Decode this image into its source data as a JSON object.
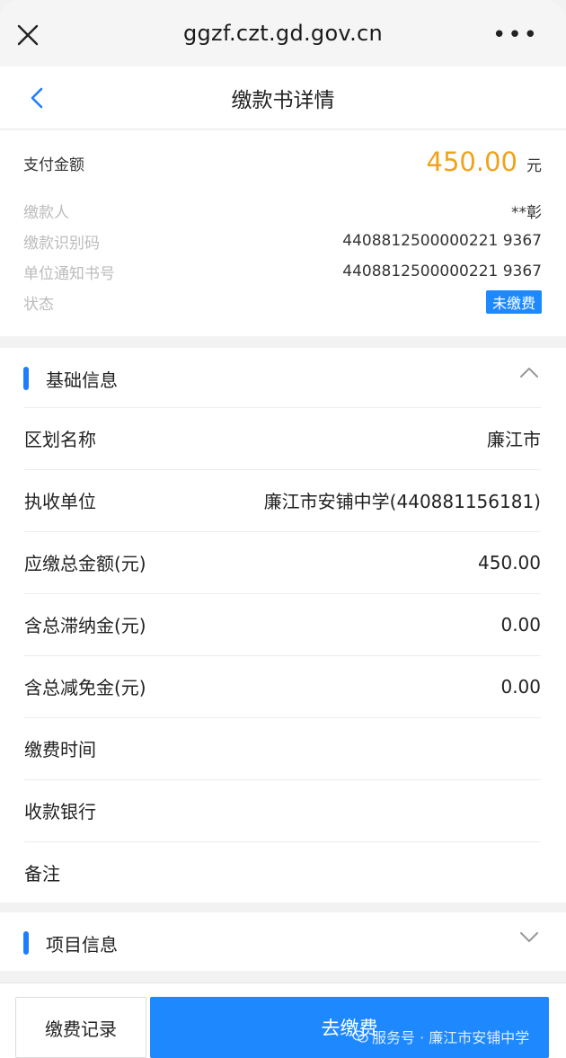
{
  "browser": {
    "url": "ggzf.czt.gd.gov.cn",
    "more": "•••"
  },
  "nav": {
    "title": "缴款书详情"
  },
  "summary": {
    "amount_label": "支付金额",
    "amount_value": "450.00",
    "amount_unit": "元",
    "rows": [
      {
        "label": "缴款人",
        "value": "**彰"
      },
      {
        "label": "缴款识别码",
        "value": "4408812500000221 9367"
      },
      {
        "label": "单位通知书号",
        "value": "4408812500000221 9367"
      },
      {
        "label": "状态",
        "value": "未缴费"
      }
    ]
  },
  "basic": {
    "title": "基础信息",
    "rows": [
      {
        "label": "区划名称",
        "value": "廉江市"
      },
      {
        "label": "执收单位",
        "value": "廉江市安铺中学(440881156181)"
      },
      {
        "label": "应缴总金额(元)",
        "value": "450.00"
      },
      {
        "label": "含总滞纳金(元)",
        "value": "0.00"
      },
      {
        "label": "含总减免金(元)",
        "value": "0.00"
      },
      {
        "label": "缴费时间",
        "value": ""
      },
      {
        "label": "收款银行",
        "value": ""
      },
      {
        "label": "备注",
        "value": ""
      }
    ]
  },
  "project": {
    "title": "项目信息"
  },
  "actions": {
    "record_label": "缴费记录",
    "pay_label": "去缴费"
  },
  "watermark": {
    "text": "服务号 · 廉江市安铺中学"
  },
  "colors": {
    "accent": "#1e88ff",
    "amount": "#f0a21b"
  }
}
